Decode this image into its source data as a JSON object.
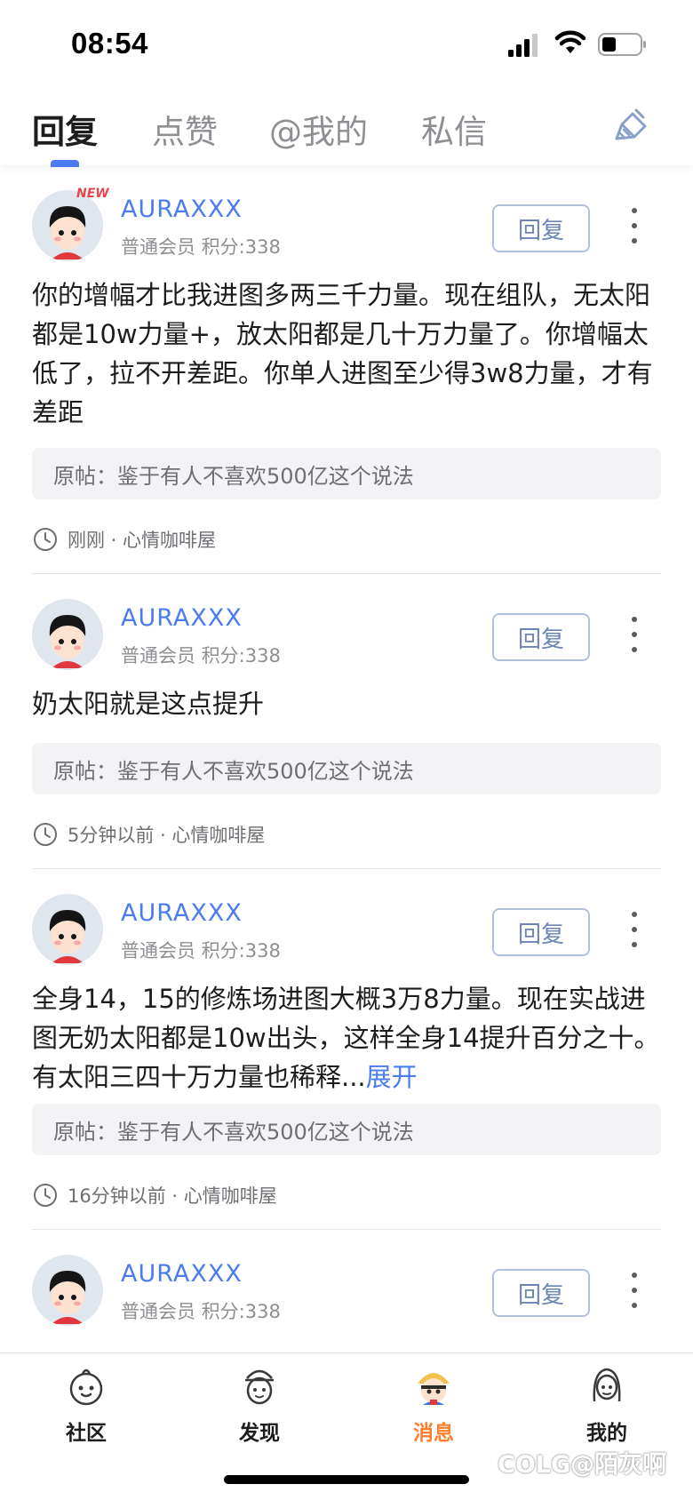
{
  "status_bar": {
    "time": "08:54"
  },
  "tabs": [
    {
      "label": "回复",
      "active": true
    },
    {
      "label": "点赞",
      "active": false
    },
    {
      "label": "@我的",
      "active": false
    },
    {
      "label": "私信",
      "active": false
    }
  ],
  "items": [
    {
      "new_badge": "NEW",
      "username": "AURAXXX",
      "meta": "普通会员 积分:338",
      "reply_label": "回复",
      "content": "你的增幅才比我进图多两三千力量。现在组队，无太阳都是10w力量+，放太阳都是几十万力量了。你增幅太低了，拉不开差距。你单人进图至少得3w8力量，才有差距",
      "quote": "原帖：鉴于有人不喜欢500亿这个说法",
      "time": "刚刚 · 心情咖啡屋"
    },
    {
      "username": "AURAXXX",
      "meta": "普通会员 积分:338",
      "reply_label": "回复",
      "content": "奶太阳就是这点提升",
      "quote": "原帖：鉴于有人不喜欢500亿这个说法",
      "time": "5分钟以前 · 心情咖啡屋"
    },
    {
      "username": "AURAXXX",
      "meta": "普通会员 积分:338",
      "reply_label": "回复",
      "content": "全身14，15的修炼场进图大概3万8力量。现在实战进图无奶太阳都是10w出头，这样全身14提升百分之十。有太阳三四十万力量也稀释...",
      "expand": "展开",
      "quote": "原帖：鉴于有人不喜欢500亿这个说法",
      "time": "16分钟以前 · 心情咖啡屋"
    },
    {
      "username": "AURAXXX",
      "meta": "普通会员 积分:338",
      "reply_label": "回复"
    }
  ],
  "bottom_nav": [
    {
      "label": "社区",
      "icon": "community-icon",
      "active": false
    },
    {
      "label": "发现",
      "icon": "discover-icon",
      "active": false
    },
    {
      "label": "消息",
      "icon": "messages-icon",
      "active": true
    },
    {
      "label": "我的",
      "icon": "profile-icon",
      "active": false
    }
  ],
  "watermark": "COLG@陌灰啊",
  "colors": {
    "accent": "#4a7cf0",
    "active_nav": "#ff7d2d"
  }
}
